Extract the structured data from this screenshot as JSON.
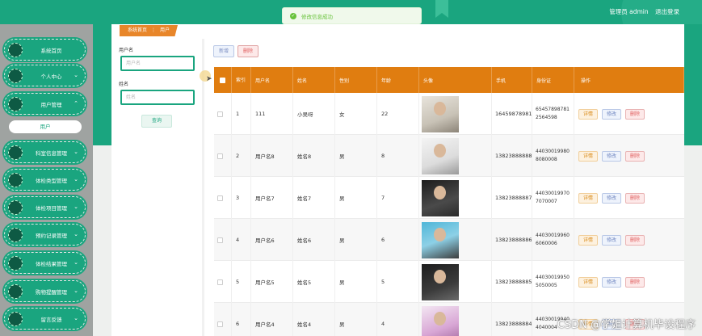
{
  "header": {
    "user_label": "管理员 admin",
    "logout_label": "退出登录",
    "brand_color": "#1aa57f"
  },
  "toast": {
    "message": "修改信息成功",
    "icon": "success-check-icon"
  },
  "sidebar": {
    "items": [
      {
        "label": "系统首页",
        "has_arrow": false
      },
      {
        "label": "个人中心",
        "has_arrow": true
      },
      {
        "label": "用户管理",
        "has_arrow": true,
        "expanded": true
      },
      {
        "label": "科室信息管理",
        "has_arrow": true
      },
      {
        "label": "体检类型管理",
        "has_arrow": true
      },
      {
        "label": "体检项目管理",
        "has_arrow": true
      },
      {
        "label": "预约记录管理",
        "has_arrow": true
      },
      {
        "label": "体检结果管理",
        "has_arrow": true
      },
      {
        "label": "购物提醒管理",
        "has_arrow": true
      },
      {
        "label": "留言反馈",
        "has_arrow": true
      }
    ],
    "sub_item": "用户"
  },
  "breadcrumb": {
    "home": "系统首页",
    "separator": "⋮",
    "current": "用户"
  },
  "search": {
    "username_label": "用户名",
    "username_placeholder": "用户名",
    "name_label": "姓名",
    "name_placeholder": "姓名",
    "query_button": "查询"
  },
  "toolbar": {
    "add_label": "新增",
    "delete_label": "删除"
  },
  "table": {
    "columns": [
      "索引",
      "用户名",
      "姓名",
      "性别",
      "年龄",
      "头像",
      "手机",
      "身份证",
      "操作"
    ],
    "rows": [
      {
        "index": "1",
        "username": "111",
        "name": "小吴呀",
        "gender": "女",
        "age": "22",
        "phone": "16459878981",
        "id_card_1": "65457898781",
        "id_card_2": "2564598"
      },
      {
        "index": "2",
        "username": "用户名8",
        "name": "姓名8",
        "gender": "男",
        "age": "8",
        "phone": "13823888888",
        "id_card_1": "44030019980",
        "id_card_2": "8080008"
      },
      {
        "index": "3",
        "username": "用户名7",
        "name": "姓名7",
        "gender": "男",
        "age": "7",
        "phone": "13823888887",
        "id_card_1": "44030019970",
        "id_card_2": "7070007"
      },
      {
        "index": "4",
        "username": "用户名6",
        "name": "姓名6",
        "gender": "男",
        "age": "6",
        "phone": "13823888886",
        "id_card_1": "44030019960",
        "id_card_2": "6060006"
      },
      {
        "index": "5",
        "username": "用户名5",
        "name": "姓名5",
        "gender": "男",
        "age": "5",
        "phone": "13823888885",
        "id_card_1": "44030019950",
        "id_card_2": "5050005"
      },
      {
        "index": "6",
        "username": "用户名4",
        "name": "姓名4",
        "gender": "男",
        "age": "4",
        "phone": "13823888884",
        "id_card_1": "44030019940",
        "id_card_2": "4040004"
      }
    ],
    "actions": {
      "detail": "详情",
      "edit": "修改",
      "delete": "删除"
    },
    "header_color": "#e07d10"
  },
  "watermark": "CSDN @学姐计算机毕设程序"
}
